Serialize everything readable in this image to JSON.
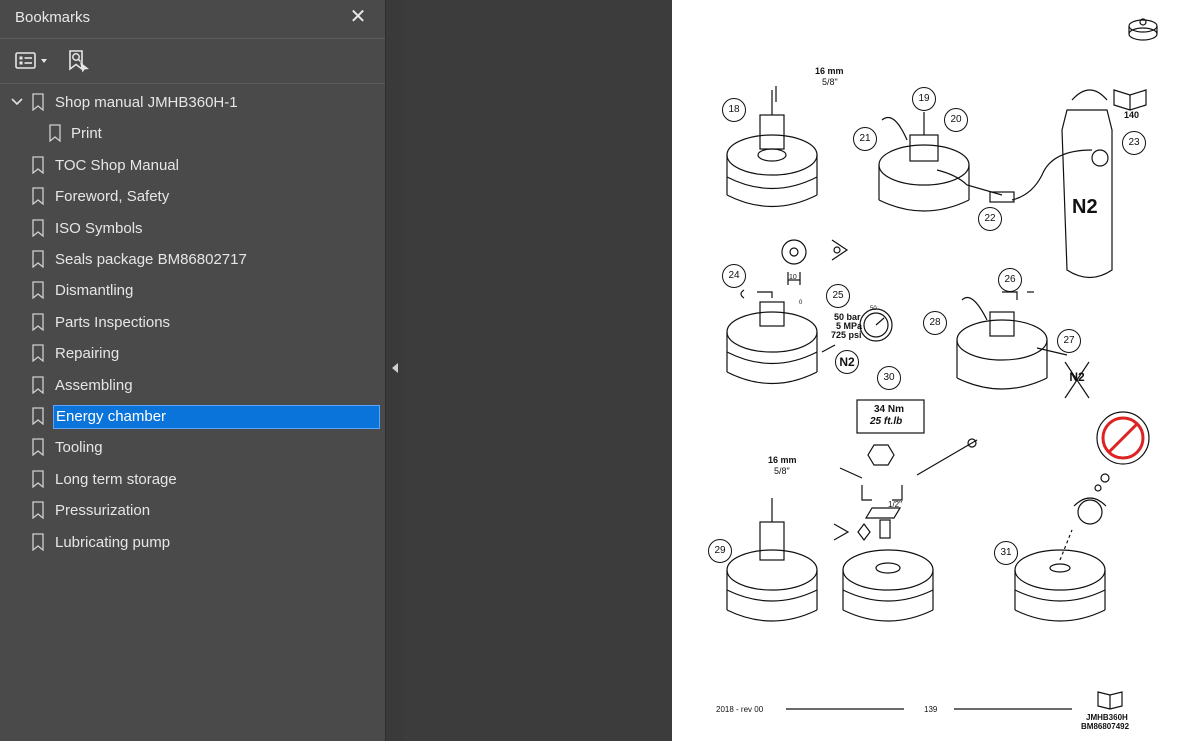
{
  "sidebar": {
    "title": "Bookmarks",
    "close_icon": "close-icon",
    "toolbar": {
      "options_icon": "list-options-icon",
      "find_icon": "bookmark-search-icon"
    },
    "items": [
      {
        "label": "Shop manual JMHB360H-1",
        "expanded": true,
        "level": 0
      },
      {
        "label": "Print",
        "level": 1
      },
      {
        "label": "TOC Shop Manual",
        "level": 0
      },
      {
        "label": "Foreword, Safety",
        "level": 0
      },
      {
        "label": "ISO Symbols",
        "level": 0
      },
      {
        "label": "Seals package BM86802717",
        "level": 0
      },
      {
        "label": "Dismantling",
        "level": 0
      },
      {
        "label": "Parts Inspections",
        "level": 0
      },
      {
        "label": "Repairing",
        "level": 0
      },
      {
        "label": "Assembling",
        "level": 0
      },
      {
        "label": "Energy chamber",
        "level": 0,
        "selected": true
      },
      {
        "label": "Tooling",
        "level": 0
      },
      {
        "label": "Long term storage",
        "level": 0
      },
      {
        "label": "Pressurization",
        "level": 0
      },
      {
        "label": "Lubricating pump",
        "level": 0
      }
    ]
  },
  "page": {
    "step_numbers": [
      "18",
      "19",
      "20",
      "21",
      "22",
      "23",
      "24",
      "25",
      "26",
      "27",
      "28",
      "29",
      "30",
      "31"
    ],
    "wrench1": {
      "size": "16 mm",
      "inch": "5/8\""
    },
    "book_ref": "140",
    "gauge_mark": "10",
    "pressure": {
      "bar": "50 bar",
      "mpa": "5 MPa",
      "psi": "725 psi",
      "dial": "50",
      "zero": "0"
    },
    "n2": "N2",
    "torque": {
      "nm": "34 Nm",
      "ftlb": "25  ft.lb"
    },
    "wrench2": {
      "size": "16 mm",
      "inch": "5/8\""
    },
    "drive": "1/2\"",
    "footer": {
      "date": "2018 -  rev 00",
      "page_no": "139",
      "model": "JMHB360H",
      "part_no": "BM86807492"
    }
  },
  "colors": {
    "sidebar_bg": "#4a4a4a",
    "viewer_bg": "#3c3c3c",
    "selection": "#0a74da",
    "page_bg": "#ffffff"
  }
}
